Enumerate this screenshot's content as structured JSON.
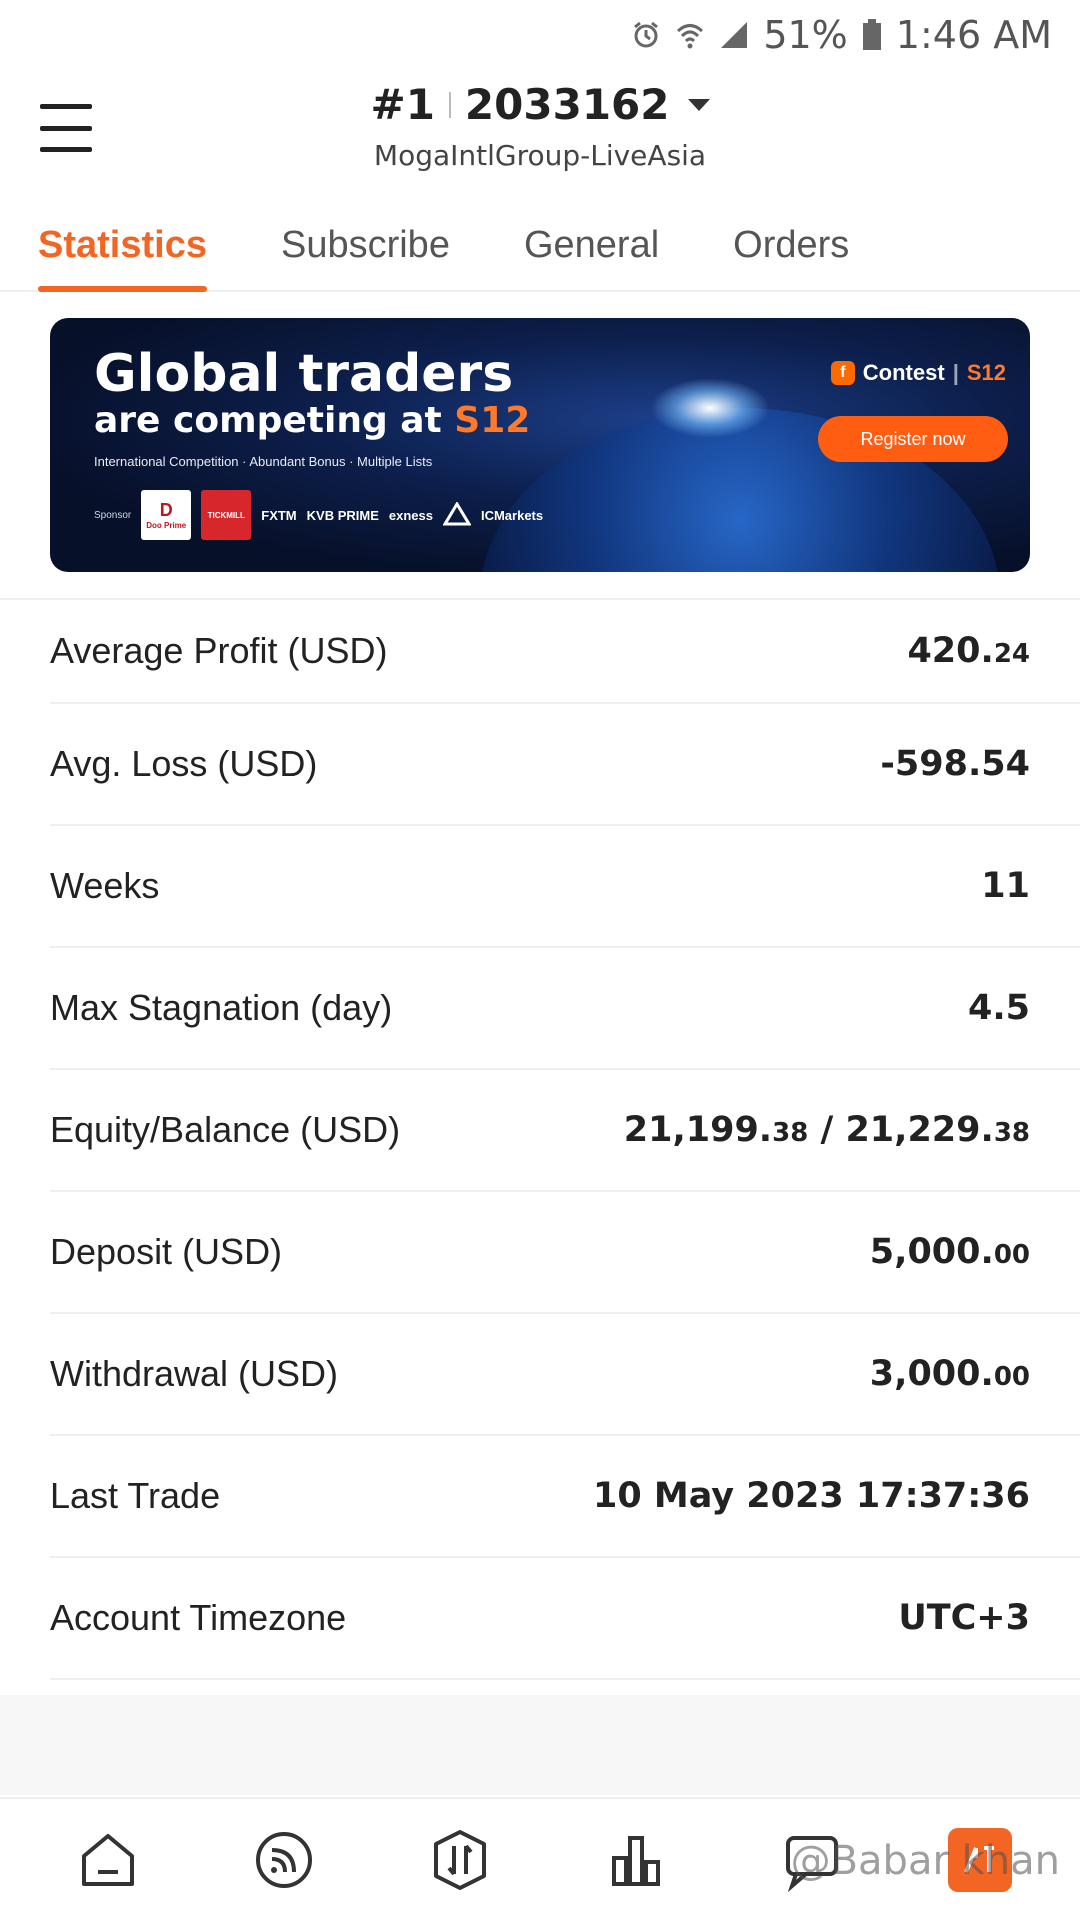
{
  "status_bar": {
    "battery": "51%",
    "time": "1:46 AM",
    "icons": [
      "alarm-icon",
      "wifi-icon",
      "signal-icon",
      "battery-icon"
    ]
  },
  "header": {
    "rank": "#1",
    "account_number": "2033162",
    "server": "MogaIntlGroup-LiveAsia"
  },
  "tabs": [
    {
      "label": "Statistics",
      "active": true
    },
    {
      "label": "Subscribe",
      "active": false
    },
    {
      "label": "General",
      "active": false
    },
    {
      "label": "Orders",
      "active": false
    }
  ],
  "banner": {
    "title_line1": "Global traders",
    "title_line2_prefix": "are competing at ",
    "title_line2_brand": "S12",
    "info": "International Competition · Abundant Bonus · Multiple Lists",
    "sponsor_label": "Sponsor",
    "sponsors": [
      "Doo Prime",
      "TICKMILL",
      "FXTM",
      "KVB PRIME",
      "exness",
      "ACCUINDEX",
      "ICMarkets"
    ],
    "contest_label": "Contest",
    "contest_brand": "S12",
    "register_label": "Register now"
  },
  "stats": [
    {
      "label": "Average Profit (USD)",
      "main": "420.",
      "dec": "24"
    },
    {
      "label": "Avg. Loss (USD)",
      "main": "-598.54",
      "dec": ""
    },
    {
      "label": "Weeks",
      "main": "11",
      "dec": ""
    },
    {
      "label": "Max Stagnation (day)",
      "main": "4.5",
      "dec": ""
    },
    {
      "label": "Equity/Balance (USD)",
      "main": "21,199.",
      "dec": "38",
      "main2": " / 21,229.",
      "dec2": "38"
    },
    {
      "label": "Deposit (USD)",
      "main": "5,000.",
      "dec": "00"
    },
    {
      "label": "Withdrawal (USD)",
      "main": "3,000.",
      "dec": "00"
    },
    {
      "label": "Last Trade",
      "main": "10 May 2023 17:37:36",
      "dec": ""
    },
    {
      "label": "Account Timezone",
      "main": "UTC+3",
      "dec": ""
    }
  ],
  "bottom_nav": [
    "home-icon",
    "feed-icon",
    "trade-icon",
    "chart-icon",
    "message-icon",
    "account-icon"
  ],
  "colors": {
    "accent": "#f26522",
    "text": "#222222",
    "divider": "#eeeeee"
  },
  "watermark": "@Babar khan"
}
